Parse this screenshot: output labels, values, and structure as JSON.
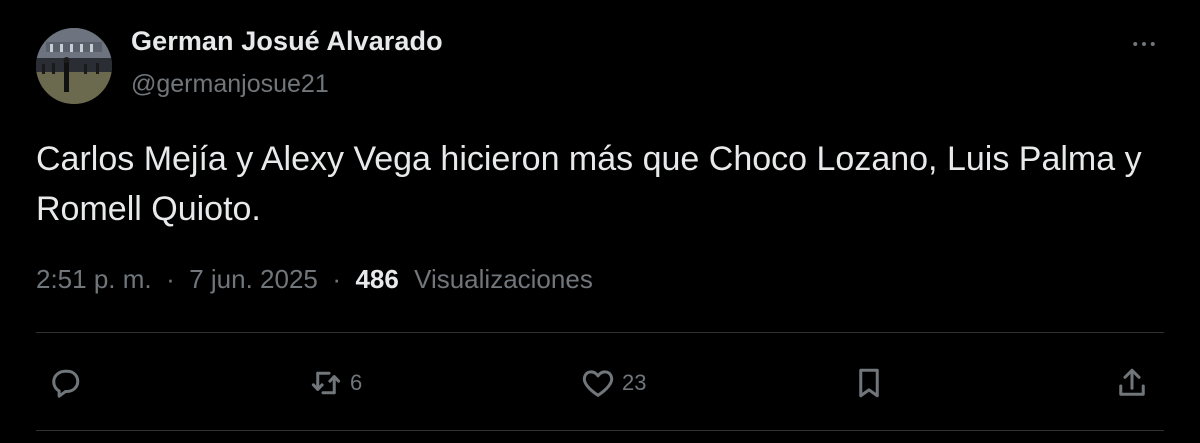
{
  "author": {
    "display_name": "German Josué Alvarado",
    "handle": "@germanjosue21"
  },
  "tweet": {
    "text": "Carlos Mejía y Alexy Vega hicieron más que Choco Lozano, Luis Palma y Romell Quioto.",
    "time": "2:51 p. m.",
    "separator": "·",
    "date": "7 jun. 2025",
    "views_count": "486",
    "views_label": "Visualizaciones"
  },
  "actions": {
    "reply_count": "",
    "retweet_count": "6",
    "like_count": "23"
  },
  "icons": {
    "more": "more-horizontal-icon",
    "reply": "reply-icon",
    "retweet": "retweet-icon",
    "like": "heart-icon",
    "bookmark": "bookmark-icon",
    "share": "share-icon"
  },
  "colors": {
    "background": "#000000",
    "primary_text": "#e7e9ea",
    "secondary_text": "#71767b",
    "divider": "#2f3336"
  }
}
